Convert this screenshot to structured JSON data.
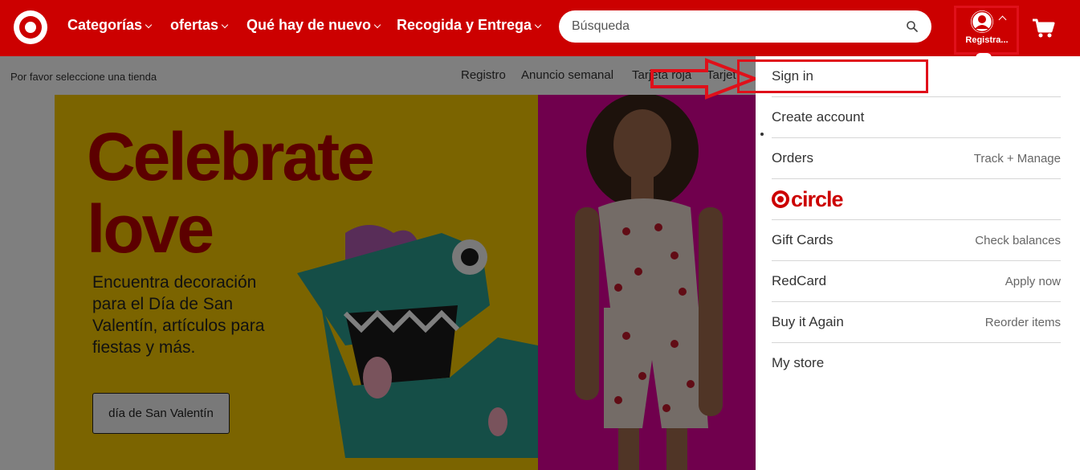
{
  "header": {
    "nav": [
      {
        "label": "Categorías"
      },
      {
        "label": "ofertas"
      },
      {
        "label": "Qué hay de nuevo"
      },
      {
        "label": "Recogida y Entrega"
      }
    ],
    "search_placeholder": "Búsqueda",
    "account_label": "Registra...",
    "brand_color": "#cc0000"
  },
  "subbar": {
    "store": "Por favor seleccione una tienda",
    "links": [
      "Registro",
      "Anuncio semanal",
      "Tarjeta roja",
      "Tarjet"
    ]
  },
  "banner": {
    "headline": [
      "Celebrate",
      "love"
    ],
    "subtext": "Encuentra decoración para el Día de San Valentín, artículos para fiestas y más.",
    "cta": "día de San Valentín"
  },
  "dropdown": {
    "items": [
      {
        "label": "Sign in",
        "sub": ""
      },
      {
        "label": "Create account",
        "sub": ""
      },
      {
        "label": "Orders",
        "sub": "Track + Manage"
      },
      {
        "label": "circle",
        "sub": ""
      },
      {
        "label": "Gift Cards",
        "sub": "Check balances"
      },
      {
        "label": "RedCard",
        "sub": "Apply now"
      },
      {
        "label": "Buy it Again",
        "sub": "Reorder items"
      },
      {
        "label": "My store",
        "sub": ""
      }
    ]
  },
  "annotation_color": "#e0101a"
}
